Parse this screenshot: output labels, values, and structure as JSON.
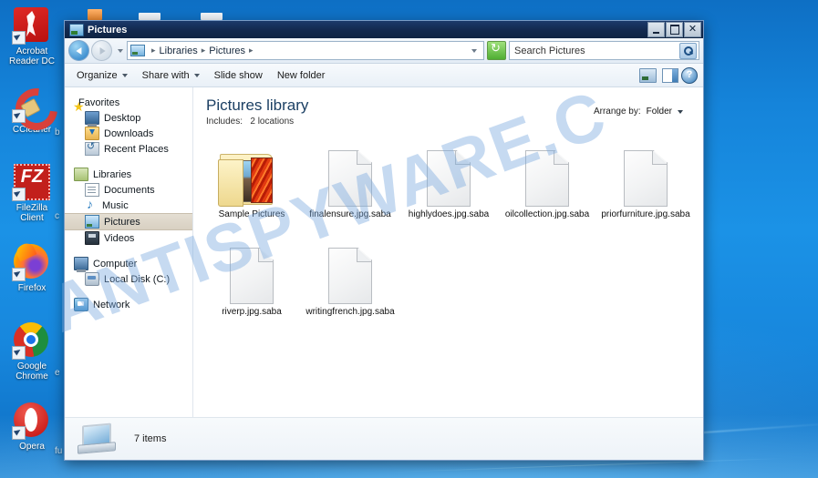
{
  "desktop": {
    "icons": [
      {
        "label": "Acrobat Reader DC",
        "icon": "acrobat-reader-icon"
      },
      {
        "label": "CCleaner",
        "icon": "ccleaner-icon"
      },
      {
        "label": "FileZilla Client",
        "icon": "filezilla-icon"
      },
      {
        "label": "Firefox",
        "icon": "firefox-icon"
      },
      {
        "label": "Google Chrome",
        "icon": "chrome-icon"
      },
      {
        "label": "Opera",
        "icon": "opera-icon"
      }
    ],
    "partial_labels": [
      "b",
      "c",
      "e",
      "fu"
    ]
  },
  "watermark": {
    "text": "ANTISPYWARE.C",
    "color": "#78a8de"
  },
  "window": {
    "title": "Pictures",
    "buttons": {
      "minimize": "–",
      "maximize": "□",
      "close": "✕"
    }
  },
  "navbar": {
    "back_tooltip": "Back",
    "forward_tooltip": "Forward",
    "breadcrumbs": [
      "Libraries",
      "Pictures"
    ],
    "separator": "▸",
    "refresh": "refresh-icon"
  },
  "search": {
    "placeholder": "Search Pictures",
    "value": "Search Pictures"
  },
  "toolbar": {
    "items": [
      {
        "label": "Organize",
        "has_caret": true
      },
      {
        "label": "Share with",
        "has_caret": true
      },
      {
        "label": "Slide show",
        "has_caret": false
      },
      {
        "label": "New folder",
        "has_caret": false
      }
    ],
    "right_icons": [
      "view-icon",
      "view-caret-icon",
      "preview-pane-icon",
      "help-icon"
    ]
  },
  "sidebar": {
    "groups": [
      {
        "header": {
          "label": "Favorites",
          "icon": "star-icon"
        },
        "items": [
          {
            "label": "Desktop",
            "icon": "desktop-icon"
          },
          {
            "label": "Downloads",
            "icon": "downloads-icon"
          },
          {
            "label": "Recent Places",
            "icon": "recent-places-icon"
          }
        ]
      },
      {
        "header": {
          "label": "Libraries",
          "icon": "libraries-icon"
        },
        "items": [
          {
            "label": "Documents",
            "icon": "documents-icon"
          },
          {
            "label": "Music",
            "icon": "music-icon"
          },
          {
            "label": "Pictures",
            "icon": "pictures-icon",
            "selected": true
          },
          {
            "label": "Videos",
            "icon": "videos-icon"
          }
        ]
      },
      {
        "header": {
          "label": "Computer",
          "icon": "computer-icon"
        },
        "items": [
          {
            "label": "Local Disk (C:)",
            "icon": "local-disk-icon"
          }
        ]
      },
      {
        "header": {
          "label": "Network",
          "icon": "network-icon"
        },
        "items": []
      }
    ]
  },
  "library": {
    "title": "Pictures library",
    "includes_label": "Includes:",
    "includes_value": "2 locations",
    "arrange_label": "Arrange by:",
    "arrange_value": "Folder"
  },
  "files": [
    {
      "name": "Sample Pictures",
      "type": "folder"
    },
    {
      "name": "finalensure.jpg.saba",
      "type": "file"
    },
    {
      "name": "highlydoes.jpg.saba",
      "type": "file"
    },
    {
      "name": "oilcollection.jpg.saba",
      "type": "file"
    },
    {
      "name": "priorfurniture.jpg.saba",
      "type": "file"
    },
    {
      "name": "riverp.jpg.saba",
      "type": "file"
    },
    {
      "name": "writingfrench.jpg.saba",
      "type": "file"
    }
  ],
  "status": {
    "item_count": "7 items"
  }
}
